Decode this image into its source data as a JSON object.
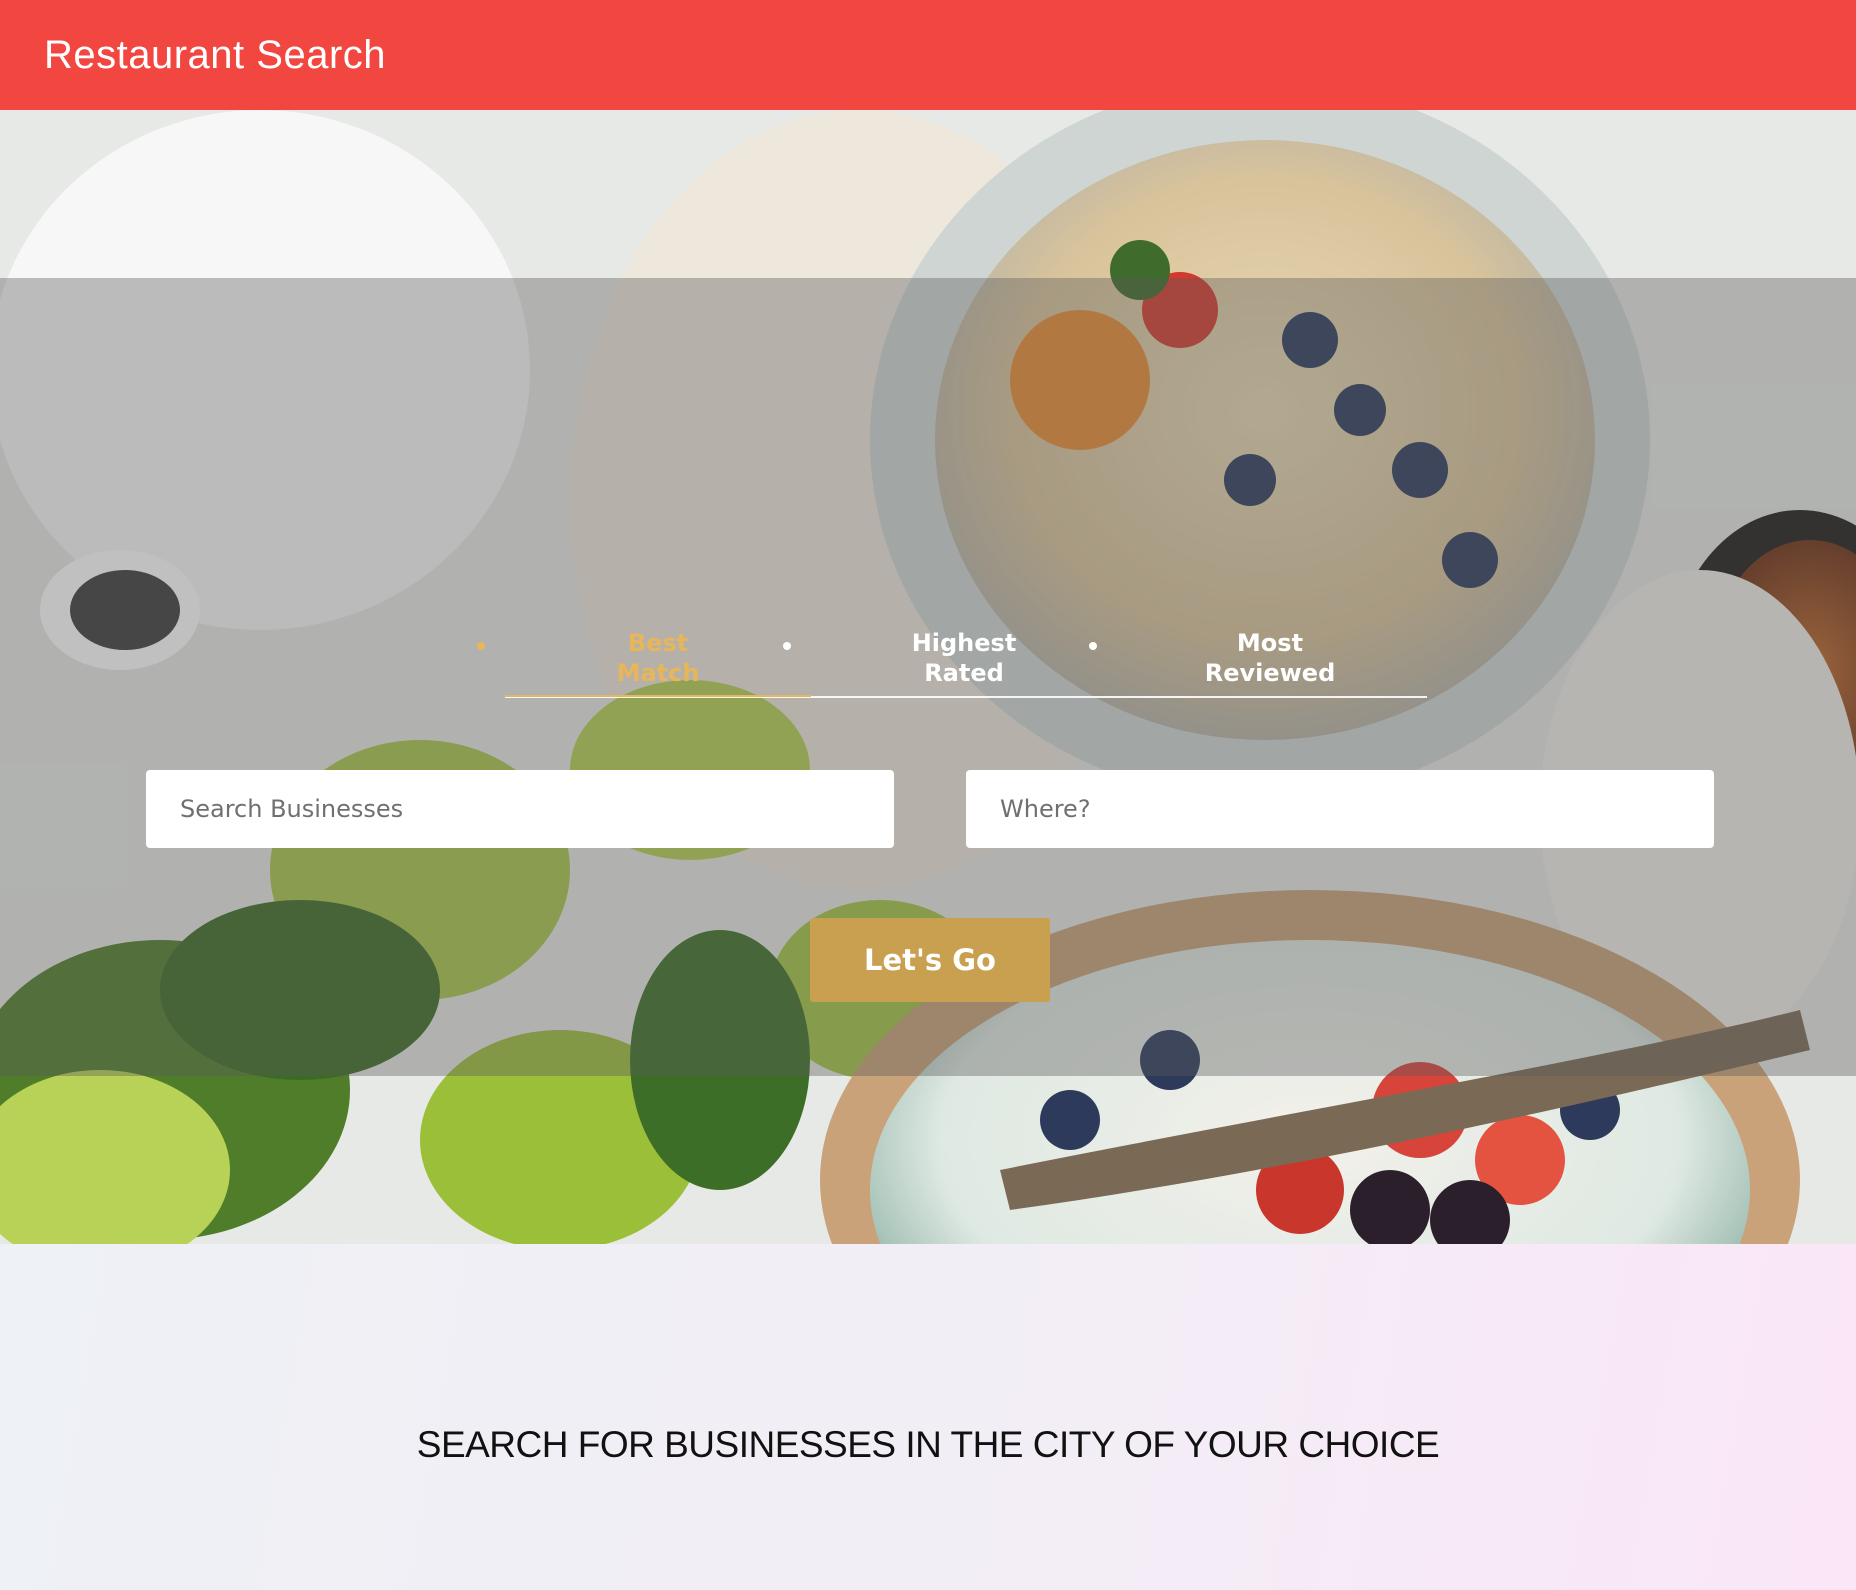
{
  "app": {
    "title": "Restaurant Search"
  },
  "colors": {
    "header": "#f24640",
    "accent": "#c9a050",
    "active_tab": "#e8b65a"
  },
  "sort_options": [
    {
      "label": "Best Match",
      "active": true
    },
    {
      "label": "Highest Rated",
      "active": false
    },
    {
      "label": "Most Reviewed",
      "active": false
    }
  ],
  "search": {
    "business_placeholder": "Search Businesses",
    "business_value": "",
    "location_placeholder": "Where?",
    "location_value": "",
    "submit_label": "Let's Go"
  },
  "tagline": "SEARCH FOR BUSINESSES IN THE CITY OF YOUR CHOICE"
}
